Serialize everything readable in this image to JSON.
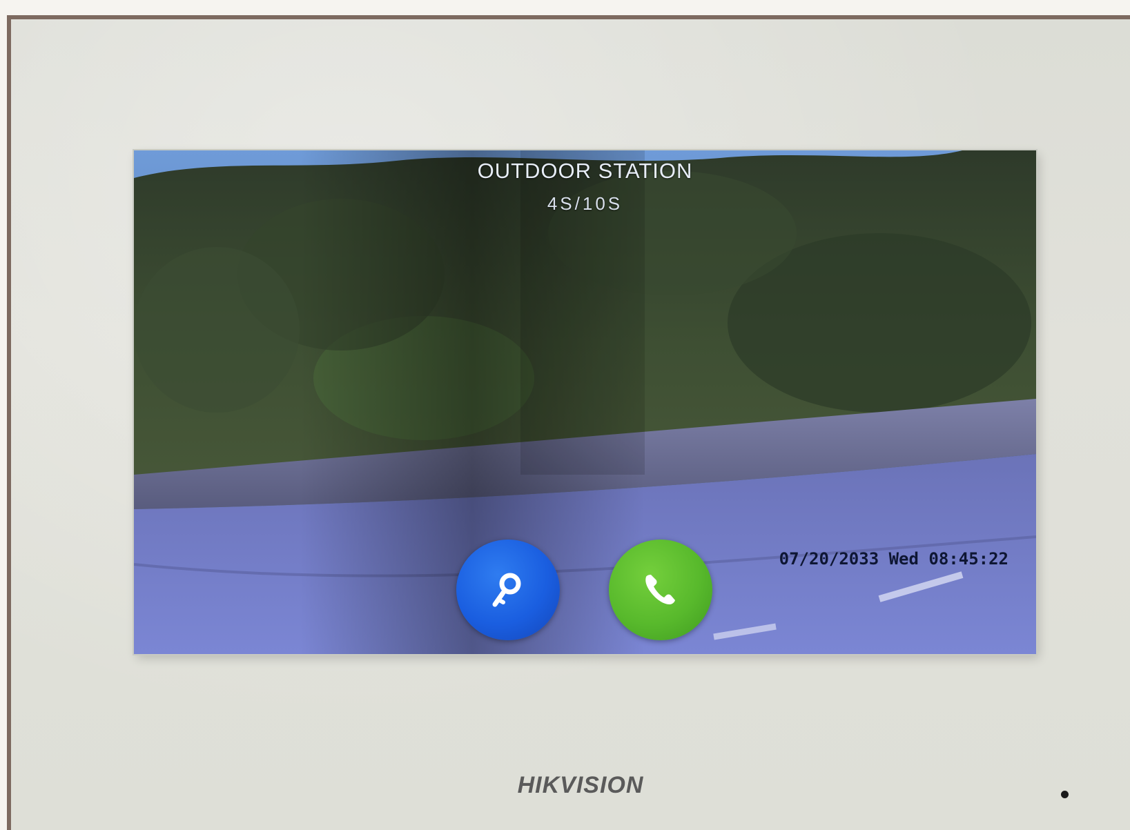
{
  "screen": {
    "title": "OUTDOOR STATION",
    "timer": "4S/10S",
    "datetime": "07/20/2033 Wed 08:45:22"
  },
  "buttons": {
    "unlock": {
      "icon": "key-icon",
      "color": "#1a5ee0"
    },
    "answer": {
      "icon": "phone-icon",
      "color": "#58b92c"
    }
  },
  "device": {
    "brand": "HIKVISION",
    "indicator": "status-led"
  }
}
